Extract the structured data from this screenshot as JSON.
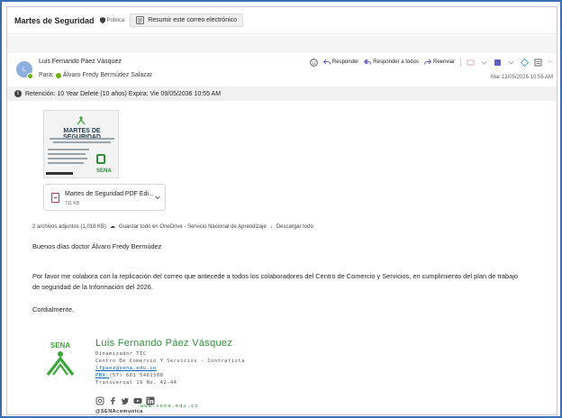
{
  "header": {
    "subject": "Martes de Seguridad",
    "visibility": "Pública",
    "summarize_label": "Resumir este correo electrónico"
  },
  "message": {
    "avatar_initial": "L",
    "sender": "Luis Fernando Páez Vásquez",
    "to_prefix": "Para:",
    "to_name": "Álvaro Fredy Bermúdez Salazar",
    "date": "Mar 12/05/2026 10:55 AM",
    "retention": "Retención: 10 Year Delete (10 años) Expira: Vie 09/05/2036 10:55 AM"
  },
  "actions": {
    "reply": "Responder",
    "reply_all": "Responder a todos",
    "forward": "Reenviar",
    "more": "···"
  },
  "thumbnail": {
    "title": "MARTES DE SEGURIDAD",
    "brand": "SENA"
  },
  "attachment": {
    "name": "Martes de Seguridad PDF Edi...",
    "size": "711 KB",
    "summary": "2 archivos adjuntos (1,018 KB)",
    "save_onedrive": "Guardar todo en OneDrive - Servicio Nacional de Aprendizaje",
    "download_all": "Descargar todo"
  },
  "body": {
    "greeting": "Buenos días doctor Álvaro Fredy Bermúdez",
    "paragraph_line1": "Por favor me colabora con la replicación del correo que antecede a todos los colaboradores del Centro de Comercio y Servicios, en cumplimiento del plan de trabajo",
    "paragraph_line2": "de seguridad de la Información del 2026.",
    "closing": "Cordialmente,"
  },
  "signature": {
    "logo_text": "SENA",
    "name": "Luis Fernando Páez Vásquez",
    "role": "Dinamizador TIC",
    "center": "Centro De Comercio Y Servicios - Contratista",
    "email": "lfpaez@sena.edu.co",
    "pbx_label": "PBX:",
    "pbx_value": "(57) 601 5461500",
    "address": "Transversal 19 No. 42-44",
    "handle": "@SENAcomunica",
    "website": "www.sena.edu.co"
  },
  "colors": {
    "frame": "#3a6db3",
    "sena_green": "#2f8f3a",
    "link": "#0563c1",
    "presence": "#6bb700"
  }
}
